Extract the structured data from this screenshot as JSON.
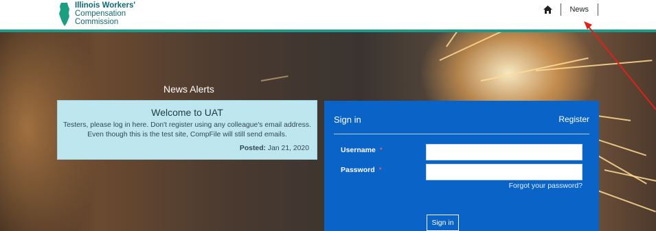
{
  "header": {
    "logo_lines": [
      "Illinois Workers'",
      "Compensation",
      "Commission"
    ],
    "nav": {
      "home_icon": "home-icon",
      "news_label": "News"
    }
  },
  "news_alerts": {
    "heading": "News Alerts",
    "alert": {
      "title": "Welcome to UAT",
      "message": "Testers, please log in here. Don't register using any colleague's email address. Even though this is the test site, CompFile will still send emails.",
      "posted_label": "Posted:",
      "posted_date": "Jan 21, 2020"
    }
  },
  "signin": {
    "title": "Sign in",
    "register_label": "Register",
    "username_label": "Username",
    "password_label": "Password",
    "required_mark": "*",
    "username_value": "",
    "password_value": "",
    "forgot_label": "Forgot your password?",
    "submit_label": "Sign in"
  },
  "colors": {
    "teal_brand": "#1b9c8c",
    "signin_panel": "#0a64c8",
    "alert_bg": "#bde6ee",
    "arrow_annotation": "#e0201c"
  }
}
